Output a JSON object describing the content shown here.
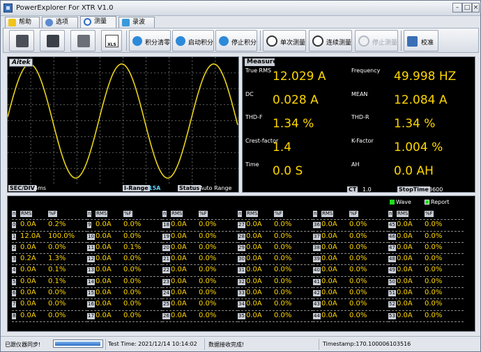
{
  "window": {
    "title": "PowerExplorer For XTR V1.0"
  },
  "tabs": [
    {
      "label": "帮助",
      "active": false
    },
    {
      "label": "选项",
      "active": false
    },
    {
      "label": "测量",
      "active": true
    },
    {
      "label": "录波",
      "active": false
    }
  ],
  "toolbar": {
    "buttons": [
      {
        "label": "积分清零"
      },
      {
        "label": "启动积分"
      },
      {
        "label": "停止积分"
      },
      {
        "label": "单次测量"
      },
      {
        "label": "连续测量"
      },
      {
        "label": "停止测量",
        "disabled": true
      },
      {
        "label": "校准"
      }
    ],
    "xls_label": "XLS"
  },
  "scope": {
    "brand": "Aitek",
    "sec_div_label": "SEC/DIV",
    "sec_div_value": "4ms",
    "irange_label": "I-Range",
    "irange_value": "15A",
    "status_label": "Status",
    "status_value": "Auto Range"
  },
  "measure": {
    "title": "Measure",
    "true_rms": {
      "label": "True RMS",
      "value": "12.029 A"
    },
    "frequency": {
      "label": "Frequency",
      "value": "49.998 HZ"
    },
    "dc": {
      "label": "DC",
      "value": "0.028 A"
    },
    "mean": {
      "label": "MEAN",
      "value": "12.084 A"
    },
    "thd_f": {
      "label": "THD-F",
      "value": "1.34 %"
    },
    "thd_r": {
      "label": "THD-R",
      "value": "1.34 %"
    },
    "crest": {
      "label": "Crest-factor",
      "value": "1.4"
    },
    "kfactor": {
      "label": "K-Factor",
      "value": "1.004 %"
    },
    "time": {
      "label": "Time",
      "value": "0.0 S"
    },
    "ah": {
      "label": "AH",
      "value": "0.0 AH"
    },
    "ct_label": "CT",
    "ct_value": "1.0",
    "stoptime_label": "StopTime",
    "stoptime_value": "3600"
  },
  "harmonics": {
    "legend_wave": "Wave",
    "legend_report": "Report",
    "header_rms": "RMS",
    "header_pf": "%F",
    "header_n": "n",
    "columns": [
      {
        "rows": [
          [
            "0",
            "0.0A",
            "0.2%"
          ],
          [
            "1",
            "12.0A",
            "100.0%"
          ],
          [
            "2",
            "0.0A",
            "0.0%"
          ],
          [
            "3",
            "0.2A",
            "1.3%"
          ],
          [
            "4",
            "0.0A",
            "0.1%"
          ],
          [
            "5",
            "0.0A",
            "0.1%"
          ],
          [
            "6",
            "0.0A",
            "0.0%"
          ],
          [
            "7",
            "0.0A",
            "0.0%"
          ],
          [
            "8",
            "0.0A",
            "0.0%"
          ]
        ]
      },
      {
        "rows": [
          [
            "9",
            "0.0A",
            "0.0%"
          ],
          [
            "10",
            "0.0A",
            "0.0%"
          ],
          [
            "11",
            "0.0A",
            "0.1%"
          ],
          [
            "12",
            "0.0A",
            "0.0%"
          ],
          [
            "13",
            "0.0A",
            "0.0%"
          ],
          [
            "14",
            "0.0A",
            "0.0%"
          ],
          [
            "15",
            "0.0A",
            "0.0%"
          ],
          [
            "16",
            "0.0A",
            "0.0%"
          ],
          [
            "17",
            "0.0A",
            "0.0%"
          ]
        ]
      },
      {
        "rows": [
          [
            "18",
            "0.0A",
            "0.0%"
          ],
          [
            "19",
            "0.0A",
            "0.0%"
          ],
          [
            "20",
            "0.0A",
            "0.0%"
          ],
          [
            "21",
            "0.0A",
            "0.0%"
          ],
          [
            "22",
            "0.0A",
            "0.0%"
          ],
          [
            "23",
            "0.0A",
            "0.0%"
          ],
          [
            "24",
            "0.0A",
            "0.0%"
          ],
          [
            "25",
            "0.0A",
            "0.0%"
          ],
          [
            "26",
            "0.0A",
            "0.0%"
          ]
        ]
      },
      {
        "rows": [
          [
            "27",
            "0.0A",
            "0.0%"
          ],
          [
            "28",
            "0.0A",
            "0.0%"
          ],
          [
            "29",
            "0.0A",
            "0.0%"
          ],
          [
            "30",
            "0.0A",
            "0.0%"
          ],
          [
            "31",
            "0.0A",
            "0.0%"
          ],
          [
            "32",
            "0.0A",
            "0.0%"
          ],
          [
            "33",
            "0.0A",
            "0.0%"
          ],
          [
            "34",
            "0.0A",
            "0.0%"
          ],
          [
            "35",
            "0.0A",
            "0.0%"
          ]
        ]
      },
      {
        "rows": [
          [
            "36",
            "0.0A",
            "0.0%"
          ],
          [
            "37",
            "0.0A",
            "0.0%"
          ],
          [
            "38",
            "0.0A",
            "0.0%"
          ],
          [
            "39",
            "0.0A",
            "0.0%"
          ],
          [
            "40",
            "0.0A",
            "0.0%"
          ],
          [
            "41",
            "0.0A",
            "0.0%"
          ],
          [
            "42",
            "0.0A",
            "0.0%"
          ],
          [
            "43",
            "0.0A",
            "0.0%"
          ],
          [
            "44",
            "0.0A",
            "0.0%"
          ]
        ]
      },
      {
        "rows": [
          [
            "45",
            "0.0A",
            "0.0%"
          ],
          [
            "46",
            "0.0A",
            "0.0%"
          ],
          [
            "47",
            "0.0A",
            "0.0%"
          ],
          [
            "48",
            "0.0A",
            "0.0%"
          ],
          [
            "49",
            "0.0A",
            "0.0%"
          ],
          [
            "50",
            "0.0A",
            "0.0%"
          ],
          [
            "51",
            "0.0A",
            "0.0%"
          ],
          [
            "52",
            "0.0A",
            "0.0%"
          ],
          [
            "53",
            "0.0A",
            "0.0%"
          ]
        ]
      }
    ]
  },
  "status": {
    "sync": "已跟仪器同步!",
    "progress_fraction": 0.95,
    "test_time": "Test Time: 2021/12/14 10:14:02",
    "message": "数据接收完成!",
    "timestamp": "Timestamp:170.100006103516"
  },
  "colors": {
    "value_yellow": "#ffd600",
    "wave_yellow": "#e8d21a",
    "panel_black": "#000000"
  }
}
